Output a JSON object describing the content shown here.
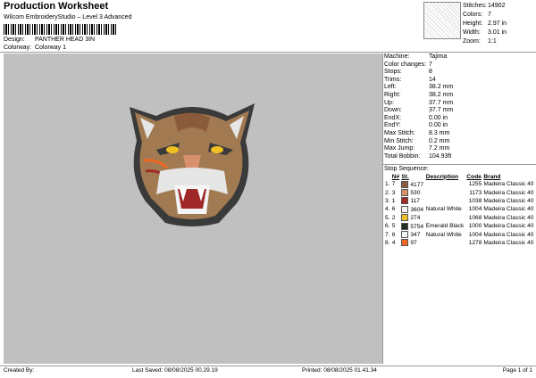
{
  "header": {
    "title": "Production Worksheet",
    "subtitle": "Wilcom EmbroideryStudio – Level 3 Advanced",
    "design_label": "Design:",
    "design_value": "PANTHER HEAD 3IN",
    "colorway_label": "Colorway:",
    "colorway_value": "Colorway 1"
  },
  "stats": [
    {
      "k": "Stitches:",
      "v": "14902"
    },
    {
      "k": "Colors:",
      "v": "7"
    },
    {
      "k": "Height:",
      "v": "2.97 in"
    },
    {
      "k": "Width:",
      "v": "3.01 in"
    },
    {
      "k": "Zoom:",
      "v": "1:1"
    }
  ],
  "info": [
    {
      "k": "Machine:",
      "v": "Tajima"
    },
    {
      "k": "Color changes:",
      "v": "7"
    },
    {
      "k": "Stops:",
      "v": "8"
    },
    {
      "k": "Trims:",
      "v": "14"
    },
    {
      "k": "Left:",
      "v": "38.2 mm"
    },
    {
      "k": "Right:",
      "v": "38.2 mm"
    },
    {
      "k": "Up:",
      "v": "37.7 mm"
    },
    {
      "k": "Down:",
      "v": "37.7 mm"
    },
    {
      "k": "EndX:",
      "v": "0.00 in"
    },
    {
      "k": "EndY:",
      "v": "0.00 in"
    },
    {
      "k": "Max Stitch:",
      "v": "8.3 mm"
    },
    {
      "k": "Min Stitch:",
      "v": "0.2 mm"
    },
    {
      "k": "Max Jump:",
      "v": "7.2 mm"
    },
    {
      "k": "Total Bobbin:",
      "v": "104.93ft"
    }
  ],
  "sequence": {
    "title": "Stop Sequence:",
    "headers": [
      "",
      "N#",
      "St.",
      "Description",
      "Code",
      "Brand"
    ],
    "rows": [
      {
        "stop": "1.",
        "n": "7",
        "color": "#8a5a3a",
        "st": "4177",
        "desc": "",
        "code": "1255",
        "brand": "Madeira Classic 40"
      },
      {
        "stop": "2.",
        "n": "3",
        "color": "#d9906c",
        "st": "530",
        "desc": "",
        "code": "1173",
        "brand": "Madeira Classic 40"
      },
      {
        "stop": "3.",
        "n": "1",
        "color": "#a02828",
        "st": "117",
        "desc": "",
        "code": "1038",
        "brand": "Madeira Classic 40"
      },
      {
        "stop": "4.",
        "n": "6",
        "color": "#f4f4f4",
        "st": "3604",
        "desc": "Natural White",
        "code": "1004",
        "brand": "Madeira Classic 40"
      },
      {
        "stop": "5.",
        "n": "2",
        "color": "#f0c020",
        "st": "274",
        "desc": "",
        "code": "1068",
        "brand": "Madeira Classic 40"
      },
      {
        "stop": "6.",
        "n": "5",
        "color": "#203020",
        "st": "5754",
        "desc": "Emerald Black",
        "code": "1000",
        "brand": "Madeira Classic 40"
      },
      {
        "stop": "7.",
        "n": "6",
        "color": "#f4f4f4",
        "st": "347",
        "desc": "Natural White",
        "code": "1004",
        "brand": "Madeira Classic 40"
      },
      {
        "stop": "8.",
        "n": "4",
        "color": "#ee6622",
        "st": "97",
        "desc": "",
        "code": "1278",
        "brand": "Madeira Classic 40"
      }
    ]
  },
  "footer": {
    "created": "Created By:",
    "saved": "Last Saved: 08/08/2025 00.29.19",
    "printed": "Printed: 08/08/2025 01.41.34",
    "page": "Page 1 of 1"
  },
  "colors": {
    "canvas": "#c0c0c0",
    "fur": "#a27a52",
    "outline": "#3a3a3a"
  }
}
